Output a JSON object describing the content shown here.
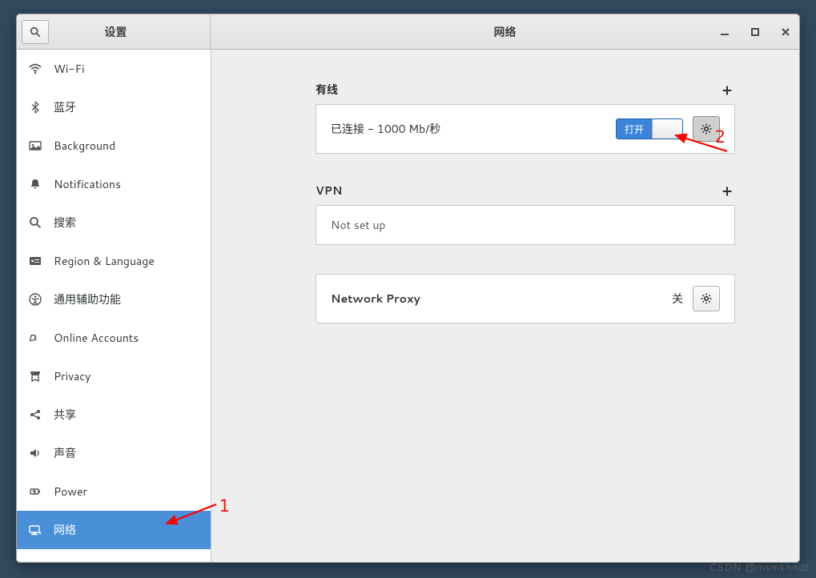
{
  "titlebar": {
    "left_title": "设置",
    "right_title": "网络"
  },
  "sidebar": {
    "items": [
      {
        "key": "wifi",
        "label": "Wi-Fi"
      },
      {
        "key": "bluetooth",
        "label": "蓝牙"
      },
      {
        "key": "background",
        "label": "Background"
      },
      {
        "key": "notifications",
        "label": "Notifications"
      },
      {
        "key": "search",
        "label": "搜索"
      },
      {
        "key": "region",
        "label": "Region & Language"
      },
      {
        "key": "accessibility",
        "label": "通用辅助功能"
      },
      {
        "key": "online-accounts",
        "label": "Online Accounts"
      },
      {
        "key": "privacy",
        "label": "Privacy"
      },
      {
        "key": "sharing",
        "label": "共享"
      },
      {
        "key": "sound",
        "label": "声音"
      },
      {
        "key": "power",
        "label": "Power"
      },
      {
        "key": "network",
        "label": "网络",
        "selected": true
      }
    ]
  },
  "network": {
    "wired": {
      "heading": "有线",
      "status": "已连接 - 1000 Mb/秒",
      "switch_on_label": "打开",
      "switch_state": true
    },
    "vpn": {
      "heading": "VPN",
      "status": "Not set up"
    },
    "proxy": {
      "label": "Network Proxy",
      "state": "关"
    }
  },
  "annotations": {
    "one": "1",
    "two": "2"
  },
  "watermark": "CSDN @msmkhndf"
}
